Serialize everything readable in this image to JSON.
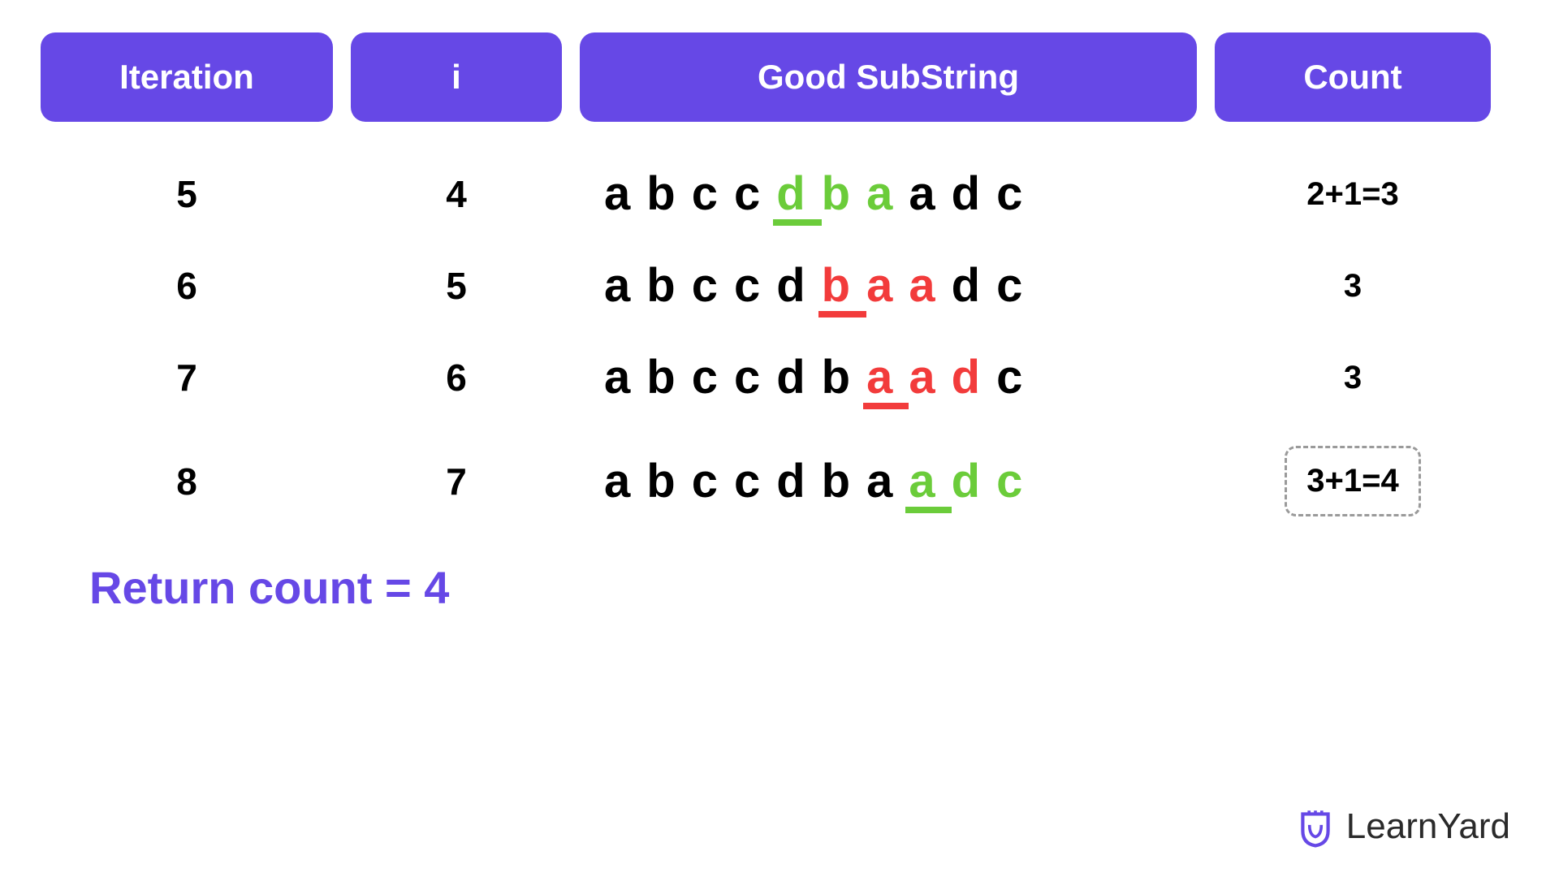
{
  "headers": {
    "iteration": "Iteration",
    "i": "i",
    "substring": "Good SubString",
    "count": "Count"
  },
  "rows": [
    {
      "iteration": "5",
      "i": "4",
      "letters": [
        {
          "ch": "a",
          "color": "black"
        },
        {
          "ch": "b",
          "color": "black"
        },
        {
          "ch": "c",
          "color": "black"
        },
        {
          "ch": "c",
          "color": "black"
        },
        {
          "ch": "d",
          "color": "green",
          "underline": "green"
        },
        {
          "ch": "b",
          "color": "green"
        },
        {
          "ch": "a",
          "color": "green"
        },
        {
          "ch": "a",
          "color": "black"
        },
        {
          "ch": "d",
          "color": "black"
        },
        {
          "ch": "c",
          "color": "black"
        }
      ],
      "count": "2+1=3",
      "boxed": false
    },
    {
      "iteration": "6",
      "i": "5",
      "letters": [
        {
          "ch": "a",
          "color": "black"
        },
        {
          "ch": "b",
          "color": "black"
        },
        {
          "ch": "c",
          "color": "black"
        },
        {
          "ch": "c",
          "color": "black"
        },
        {
          "ch": "d",
          "color": "black"
        },
        {
          "ch": "b",
          "color": "red",
          "underline": "red"
        },
        {
          "ch": "a",
          "color": "red"
        },
        {
          "ch": "a",
          "color": "red"
        },
        {
          "ch": "d",
          "color": "black"
        },
        {
          "ch": "c",
          "color": "black"
        }
      ],
      "count": "3",
      "boxed": false
    },
    {
      "iteration": "7",
      "i": "6",
      "letters": [
        {
          "ch": "a",
          "color": "black"
        },
        {
          "ch": "b",
          "color": "black"
        },
        {
          "ch": "c",
          "color": "black"
        },
        {
          "ch": "c",
          "color": "black"
        },
        {
          "ch": "d",
          "color": "black"
        },
        {
          "ch": "b",
          "color": "black"
        },
        {
          "ch": "a",
          "color": "red",
          "underline": "red"
        },
        {
          "ch": "a",
          "color": "red"
        },
        {
          "ch": "d",
          "color": "red"
        },
        {
          "ch": "c",
          "color": "black"
        }
      ],
      "count": "3",
      "boxed": false
    },
    {
      "iteration": "8",
      "i": "7",
      "letters": [
        {
          "ch": "a",
          "color": "black"
        },
        {
          "ch": "b",
          "color": "black"
        },
        {
          "ch": "c",
          "color": "black"
        },
        {
          "ch": "c",
          "color": "black"
        },
        {
          "ch": "d",
          "color": "black"
        },
        {
          "ch": "b",
          "color": "black"
        },
        {
          "ch": "a",
          "color": "black"
        },
        {
          "ch": "a",
          "color": "green",
          "underline": "green"
        },
        {
          "ch": "d",
          "color": "green"
        },
        {
          "ch": "c",
          "color": "green"
        }
      ],
      "count": "3+1=4",
      "boxed": true
    }
  ],
  "return_text": "Return count = 4",
  "brand": "LearnYard",
  "colors": {
    "purple": "#6648e6",
    "green": "#6bcc3a",
    "red": "#f23b3b"
  }
}
